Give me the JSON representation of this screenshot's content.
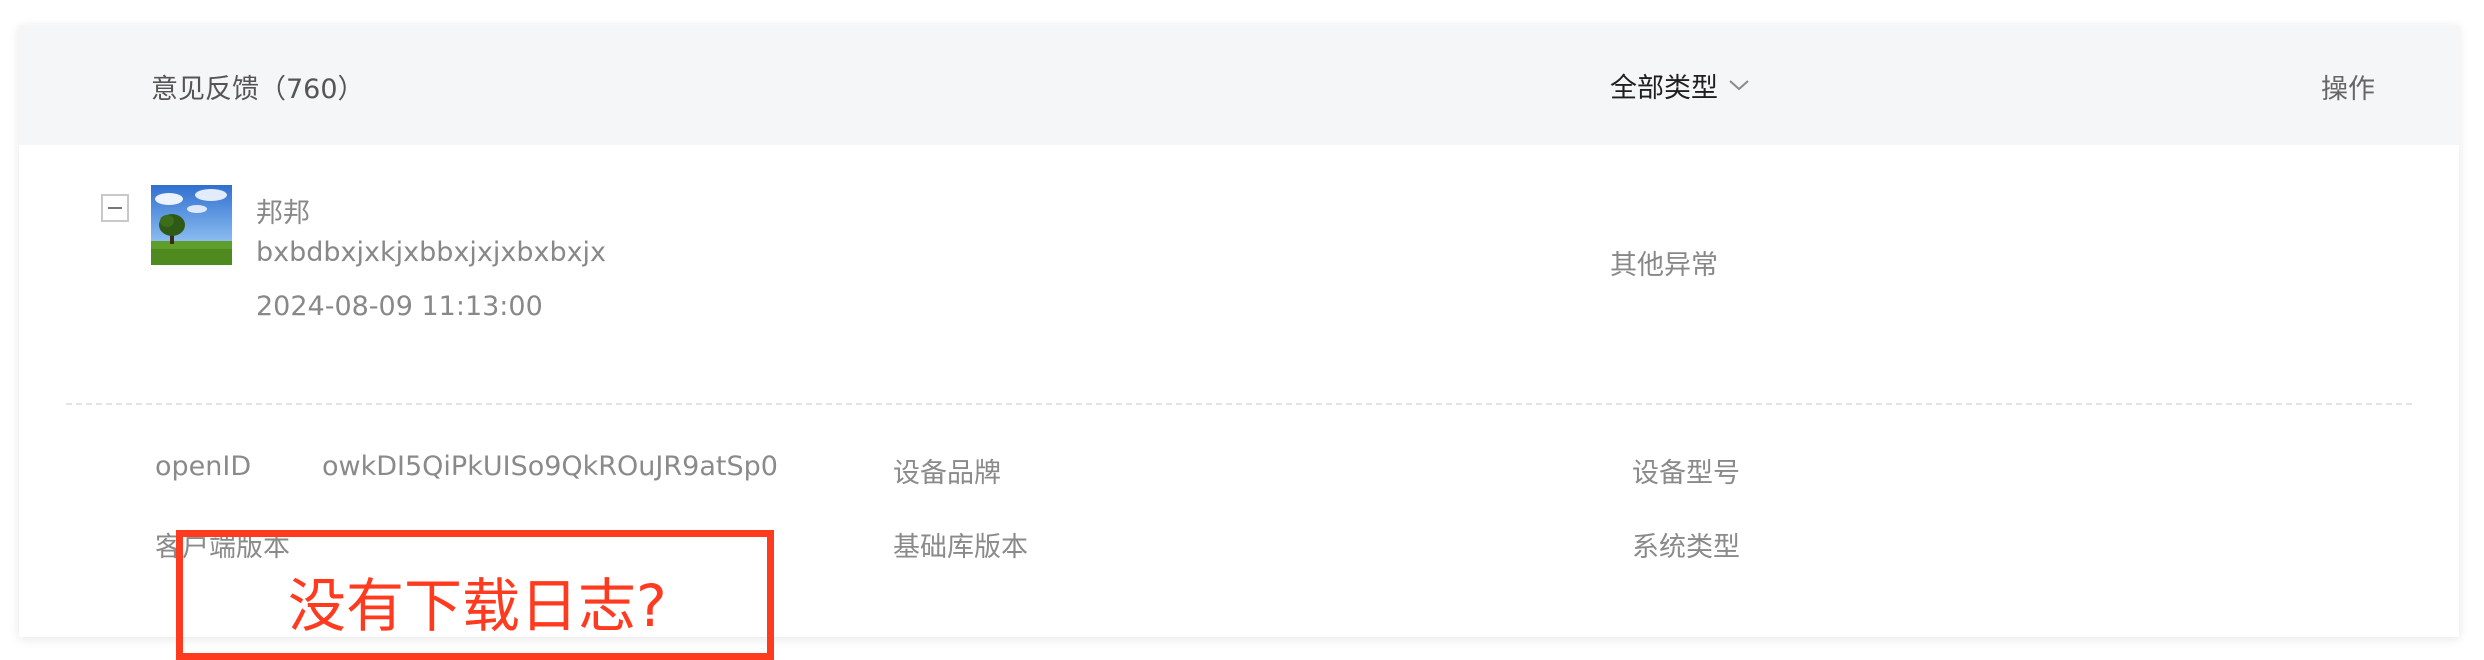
{
  "header": {
    "title": "意见反馈（760）",
    "type_filter": "全部类型",
    "operations": "操作"
  },
  "feedback": {
    "user_name": "邦邦",
    "content": "bxbdbxjxkjxbbxjxjxbxbxjx",
    "time": "2024-08-09 11:13:00",
    "type": "其他异常",
    "details": {
      "openid_label": "openID",
      "openid_value": "owkDI5QiPkUISo9QkROuJR9atSp0",
      "brand_label": "设备品牌",
      "model_label": "设备型号",
      "client_version_label": "客户端版本",
      "base_lib_label": "基础库版本",
      "system_type_label": "系统类型"
    }
  },
  "annotation": {
    "text": "没有下载日志?",
    "color": "#ff3b1f"
  },
  "icons": {
    "collapse": "collapse-icon",
    "chevron": "chevron-down-icon",
    "avatar": "avatar-image"
  }
}
